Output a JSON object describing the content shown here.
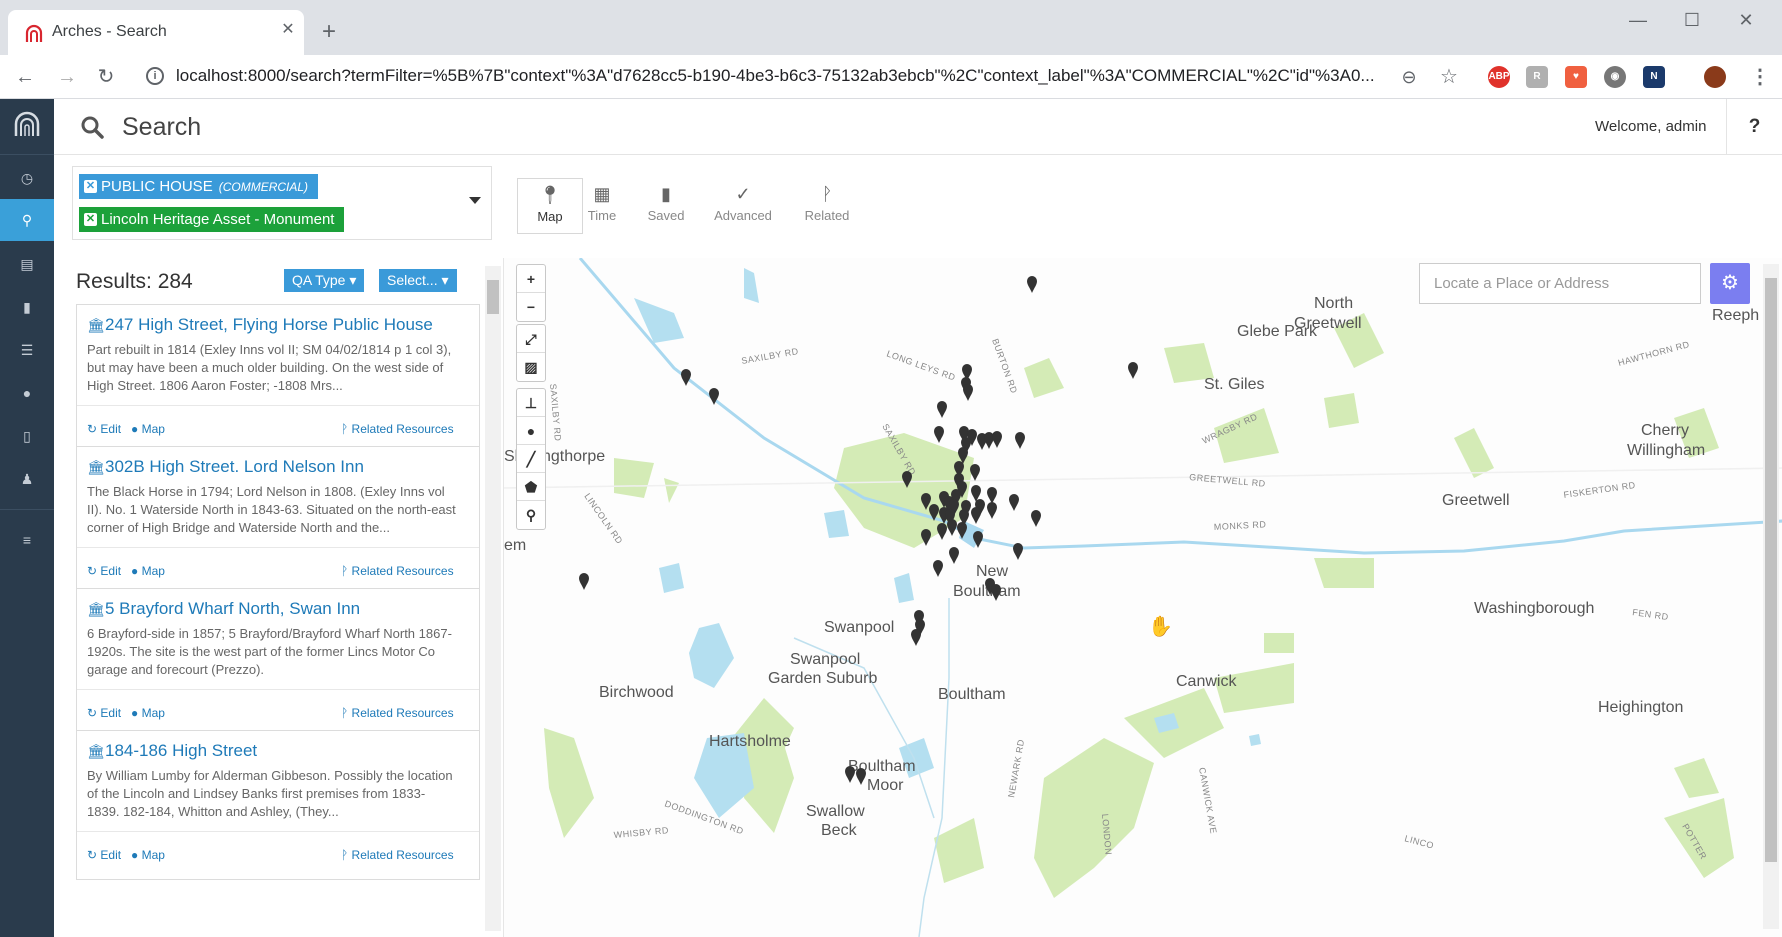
{
  "browser": {
    "tab_title": "Arches - Search",
    "tab_close": "✕",
    "new_tab": "+",
    "url": "localhost:8000/search?termFilter=%5B%7B\"context\"%3A\"d7628cc5-b190-4be3-b6c3-75132ab3ebcb\"%2C\"context_label\"%3A\"COMMERCIAL\"%2C\"id\"%3A0..."
  },
  "header": {
    "title": "Search",
    "welcome": "Welcome, admin",
    "help": "?"
  },
  "filters": {
    "tags": [
      {
        "label": "PUBLIC HOUSE",
        "context": "(COMMERCIAL)",
        "color": "#3a9ad9"
      },
      {
        "label": "Lincoln Heritage Asset - Monument",
        "context": "",
        "color": "#1ca13a"
      }
    ],
    "tabs": [
      {
        "label": "Map",
        "icon": "map-pin-icon",
        "active": true
      },
      {
        "label": "Time",
        "icon": "calendar-icon",
        "active": false
      },
      {
        "label": "Saved",
        "icon": "bookmark-icon",
        "active": false
      },
      {
        "label": "Advanced",
        "icon": "check-circle-icon",
        "active": false
      },
      {
        "label": "Related",
        "icon": "related-icon",
        "active": false
      }
    ]
  },
  "results": {
    "count_label": "Results: 284",
    "qa_type": "QA Type",
    "select": "Select...",
    "edit_label": "Edit",
    "map_label": "Map",
    "related_label": "Related Resources",
    "items": [
      {
        "title": "247 High Street, Flying Horse Public House",
        "description": "Part rebuilt in 1814 (Exley Inns vol II; SM 04/02/1814 p 1 col 3), but may have been a much older building. On the west side of High Street. 1806 Aaron Foster; -1808 Mrs..."
      },
      {
        "title": "302B High Street. Lord Nelson Inn",
        "description": "The Black Horse in 1794; Lord Nelson in 1808. (Exley Inns vol II). No. 1 Waterside North in 1843-63. Situated on the north-east corner of High Bridge and Waterside North and the..."
      },
      {
        "title": "5 Brayford Wharf North, Swan Inn",
        "description": "6 Brayford-side in 1857; 5 Brayford/Brayford Wharf North 1867-1920s. The site is the west part of the former Lincs Motor Co garage and forecourt (Prezzo)."
      },
      {
        "title": "184-186 High Street",
        "description": "By William Lumby for Alderman Gibbeson. Possibly the location of the Lincoln and Lindsey Banks first premises from 1833-1839. 182-184, Whitton and Ashley, (They..."
      }
    ]
  },
  "map": {
    "search_placeholder": "Locate a Place or Address",
    "zoom_in": "+",
    "zoom_out": "−",
    "places": [
      "North Greetwell",
      "Reeph",
      "Glebe Park",
      "St. Giles",
      "Cherry Willingham",
      "Greetwell",
      "ngthorpe",
      "em",
      "New Boultham",
      "Washingborough",
      "Swanpool",
      "Swanpool Garden Suburb",
      "Birchwood",
      "Boultham",
      "Canwick",
      "Heighington",
      "Hartsholme",
      "Boultham Moor",
      "Swallow Beck",
      "Sk"
    ],
    "roads": [
      "SAXILBY RD",
      "LONG LEYS RD",
      "BURTON RD",
      "HAWTHORN RD",
      "WRAGBY RD",
      "SAXILBY RD",
      "GREETWELL RD",
      "FISKERTON RD",
      "SAXILBY RD",
      "LINCOLN RD",
      "MONKS RD",
      "FEN RD",
      "NEWARK RD",
      "CANWICK AVE",
      "DODDINGTON RD",
      "WHISBY RD",
      "LONDON",
      "POTTER",
      "LINCO"
    ]
  },
  "colors": {
    "sidebar": "#2a3b4c",
    "accent": "#3aa0d9",
    "green_tag": "#1ca13a",
    "map_park": "#d4ebb6",
    "map_water": "#b4dff0",
    "marker": "#333333"
  }
}
